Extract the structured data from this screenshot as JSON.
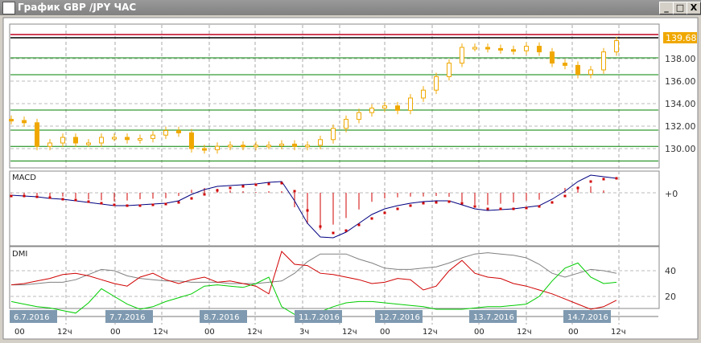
{
  "window": {
    "title": "График GBP /JPY  ЧАС",
    "minimize": "_",
    "maximize": "□",
    "close": "X"
  },
  "price_panel": {
    "current_price": "139.68",
    "axis_labels": [
      "138.00",
      "136.00",
      "134.00",
      "132.00",
      "130.00"
    ],
    "axis_values": [
      138,
      136,
      134,
      132,
      130
    ],
    "levels_red": [
      140.14
    ],
    "levels_black": [
      139.86
    ],
    "levels_green": [
      138.07,
      136.57,
      133.43,
      131.64,
      130.2,
      128.9
    ],
    "closes": [
      132.5,
      132.3,
      130.2,
      130.5,
      131.0,
      130.5,
      130.5,
      131.0,
      131.0,
      130.8,
      130.9,
      131.2,
      131.6,
      131.4,
      130.0,
      129.9,
      130.2,
      130.3,
      130.2,
      130.3,
      130.3,
      130.4,
      130.2,
      130.3,
      130.8,
      131.8,
      132.6,
      133.2,
      133.6,
      133.8,
      133.4,
      134.5,
      135.2,
      136.4,
      137.6,
      139.0,
      139.0,
      138.9,
      138.8,
      138.7,
      139.1,
      138.6,
      137.6,
      137.4,
      136.6,
      137.0,
      138.6,
      139.6
    ]
  },
  "macd_panel": {
    "label": "MACD",
    "zero_label": "+0",
    "macd": [
      -0.03,
      -0.04,
      -0.05,
      -0.07,
      -0.08,
      -0.1,
      -0.12,
      -0.14,
      -0.16,
      -0.16,
      -0.15,
      -0.14,
      -0.13,
      -0.1,
      -0.02,
      0.04,
      0.08,
      0.09,
      0.1,
      0.11,
      0.13,
      0.14,
      -0.1,
      -0.38,
      -0.55,
      -0.56,
      -0.49,
      -0.38,
      -0.27,
      -0.2,
      -0.16,
      -0.13,
      -0.11,
      -0.1,
      -0.1,
      -0.15,
      -0.2,
      -0.22,
      -0.21,
      -0.2,
      -0.18,
      -0.16,
      -0.08,
      0.02,
      0.14,
      0.22,
      0.2,
      0.18
    ],
    "signal": [
      -0.04,
      -0.04,
      -0.05,
      -0.06,
      -0.08,
      -0.09,
      -0.11,
      -0.13,
      -0.15,
      -0.16,
      -0.16,
      -0.15,
      -0.14,
      -0.12,
      -0.07,
      -0.02,
      0.03,
      0.06,
      0.08,
      0.1,
      0.11,
      0.12,
      0.02,
      -0.22,
      -0.42,
      -0.5,
      -0.47,
      -0.4,
      -0.32,
      -0.25,
      -0.2,
      -0.16,
      -0.13,
      -0.12,
      -0.11,
      -0.13,
      -0.17,
      -0.2,
      -0.2,
      -0.2,
      -0.19,
      -0.17,
      -0.12,
      -0.04,
      0.06,
      0.14,
      0.17,
      0.18
    ]
  },
  "dmi_panel": {
    "label": "DMI",
    "axis_labels": [
      "40",
      "20"
    ],
    "axis_values": [
      40,
      20
    ],
    "adx": [
      29,
      29,
      30,
      31,
      31,
      33,
      37,
      41,
      40,
      36,
      34,
      33,
      32,
      32,
      31,
      31,
      31,
      30,
      30,
      30,
      31,
      32,
      38,
      47,
      53,
      53,
      53,
      49,
      46,
      42,
      41,
      41,
      42,
      43,
      46,
      50,
      53,
      54,
      53,
      52,
      50,
      45,
      38,
      35,
      38,
      41,
      40,
      38
    ],
    "plus_di": [
      29,
      30,
      32,
      34,
      37,
      38,
      36,
      33,
      30,
      28,
      35,
      38,
      33,
      30,
      33,
      35,
      31,
      32,
      30,
      28,
      22,
      55,
      45,
      44,
      38,
      37,
      35,
      33,
      30,
      31,
      34,
      33,
      25,
      28,
      40,
      48,
      38,
      35,
      34,
      30,
      28,
      25,
      22,
      18,
      14,
      10,
      12,
      17
    ],
    "minus_di": [
      16,
      14,
      12,
      11,
      9,
      7,
      15,
      26,
      20,
      14,
      10,
      12,
      16,
      19,
      22,
      28,
      29,
      28,
      27,
      30,
      35,
      12,
      6,
      5,
      8,
      12,
      15,
      16,
      16,
      15,
      14,
      13,
      12,
      10,
      10,
      10,
      11,
      12,
      12,
      13,
      14,
      20,
      32,
      42,
      46,
      35,
      30,
      31
    ]
  },
  "time_axis": {
    "dates": [
      "6.7.2016",
      "7.7.2016",
      "8.7.2016",
      "11.7.2016",
      "12.7.2016",
      "13.7.2016",
      "14.7.2016"
    ],
    "hours": [
      [
        "00",
        "12ч"
      ],
      [
        "00",
        "12ч"
      ],
      [
        "00",
        "12ч"
      ],
      [
        "3ч",
        "12ч"
      ],
      [
        "00",
        "12ч"
      ],
      [
        "00",
        "12ч"
      ],
      [
        "00",
        "12ч"
      ]
    ]
  },
  "colors": {
    "candle": "#f0a800",
    "macd": "#000080",
    "signal": "#d00000",
    "adx": "#808080",
    "plus_di": "#d00000",
    "minus_di": "#00cc00",
    "level_green": "#008000",
    "date_box": "#7f9ab0"
  }
}
